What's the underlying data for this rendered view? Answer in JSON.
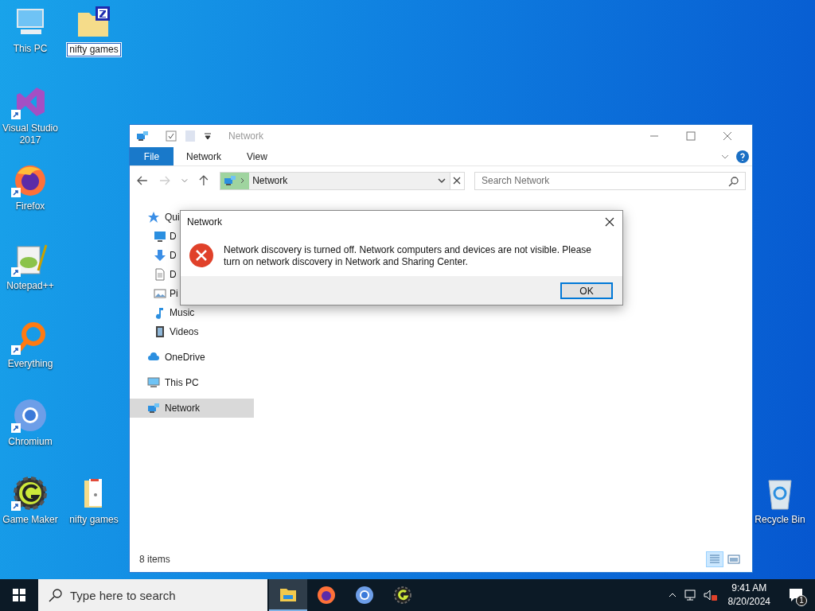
{
  "desktop_icons": [
    {
      "label": "This PC",
      "kind": "pc",
      "shortcut": false,
      "selected": false
    },
    {
      "label": "nifty games",
      "kind": "zip-folder",
      "shortcut": false,
      "selected": true
    },
    {
      "label": "Visual Studio 2017",
      "kind": "vs",
      "shortcut": true,
      "selected": false
    },
    {
      "label": "Firefox",
      "kind": "firefox",
      "shortcut": true,
      "selected": false
    },
    {
      "label": "Notepad++",
      "kind": "notepad",
      "shortcut": true,
      "selected": false
    },
    {
      "label": "Everything",
      "kind": "everything",
      "shortcut": true,
      "selected": false
    },
    {
      "label": "Chromium",
      "kind": "chromium",
      "shortcut": true,
      "selected": false
    },
    {
      "label": "Game Maker",
      "kind": "gamemaker",
      "shortcut": true,
      "selected": false
    },
    {
      "label": "nifty games",
      "kind": "folder",
      "shortcut": false,
      "selected": false
    },
    {
      "label": "Recycle Bin",
      "kind": "recycle",
      "shortcut": false,
      "selected": false
    }
  ],
  "explorer": {
    "title": "Network",
    "ribbon_tabs": [
      {
        "label": "File",
        "selected": true
      },
      {
        "label": "Network",
        "selected": false
      },
      {
        "label": "View",
        "selected": false
      }
    ],
    "address": "Network",
    "search": {
      "placeholder": "Search Network"
    },
    "nav": [
      {
        "label": "Qui",
        "kind": "star",
        "selected": false,
        "children": [
          {
            "label": "D",
            "kind": "desktop",
            "selected": false
          },
          {
            "label": "D",
            "kind": "download",
            "selected": false
          },
          {
            "label": "D",
            "kind": "document",
            "selected": false
          },
          {
            "label": "Pi",
            "kind": "pictures",
            "selected": false
          },
          {
            "label": "Music",
            "kind": "music",
            "selected": false
          },
          {
            "label": "Videos",
            "kind": "videos",
            "selected": false
          }
        ]
      },
      {
        "label": "OneDrive",
        "kind": "cloud",
        "selected": false
      },
      {
        "label": "This PC",
        "kind": "pc",
        "selected": false
      },
      {
        "label": "Network",
        "kind": "network",
        "selected": true
      }
    ],
    "status": "8 items",
    "views": [
      {
        "kind": "details",
        "selected": true
      },
      {
        "kind": "large",
        "selected": false
      }
    ]
  },
  "dialog": {
    "title": "Network",
    "message": "Network discovery is turned off. Network computers and devices are not visible. Please turn on network discovery in Network and Sharing Center.",
    "button": "OK"
  },
  "taskbar": {
    "search": {
      "placeholder": "Type here to search"
    },
    "apps": [
      {
        "kind": "explorer",
        "selected": true
      },
      {
        "kind": "firefox",
        "selected": false
      },
      {
        "kind": "chromium",
        "selected": false
      },
      {
        "kind": "gamemaker",
        "selected": false
      }
    ],
    "time": "9:41 AM",
    "date": "8/20/2024",
    "notifications": "1"
  }
}
